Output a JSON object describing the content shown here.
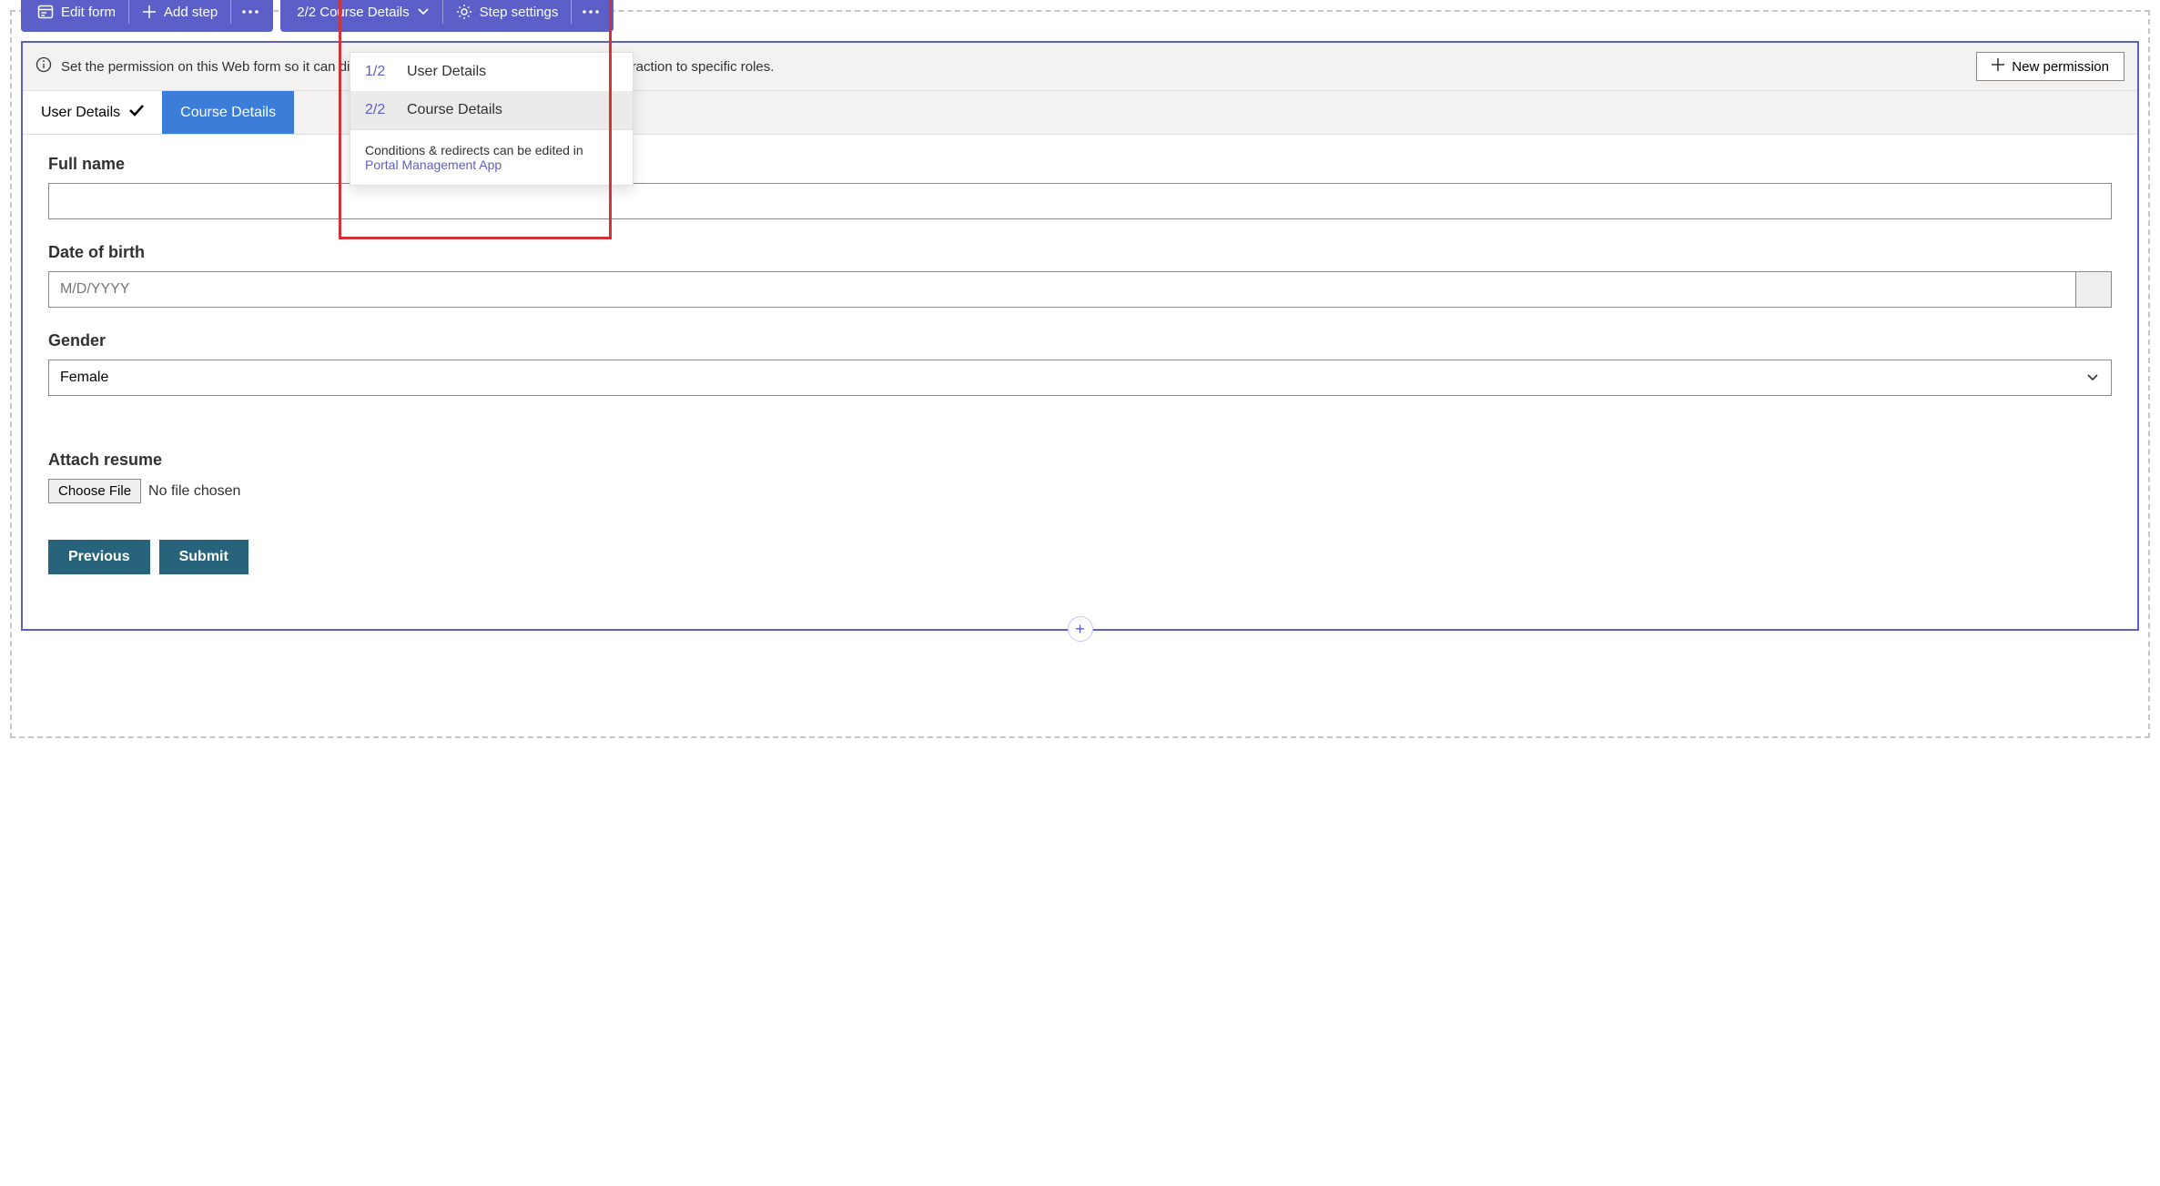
{
  "toolbar1": {
    "edit_form": "Edit form",
    "add_step": "Add step"
  },
  "toolbar2": {
    "step_label": "2/2 Course Details",
    "step_settings": "Step settings"
  },
  "dropdown": {
    "items": [
      {
        "num": "1/2",
        "label": "User Details"
      },
      {
        "num": "2/2",
        "label": "Course Details"
      }
    ],
    "footer_text": "Conditions & redirects can be edited in",
    "footer_link": "Portal Management App"
  },
  "infobar": {
    "text": "Set the permission on this Web form so it can display data to anonymous users or limit the interaction to specific roles.",
    "new_permission": "New permission"
  },
  "tabs": {
    "user_details": "User Details",
    "course_details": "Course Details"
  },
  "form": {
    "full_name_label": "Full name",
    "full_name_value": "",
    "dob_label": "Date of birth",
    "dob_placeholder": "M/D/YYYY",
    "gender_label": "Gender",
    "gender_value": "Female",
    "attach_label": "Attach resume",
    "choose_file": "Choose File",
    "file_status": "No file chosen",
    "previous": "Previous",
    "submit": "Submit"
  }
}
